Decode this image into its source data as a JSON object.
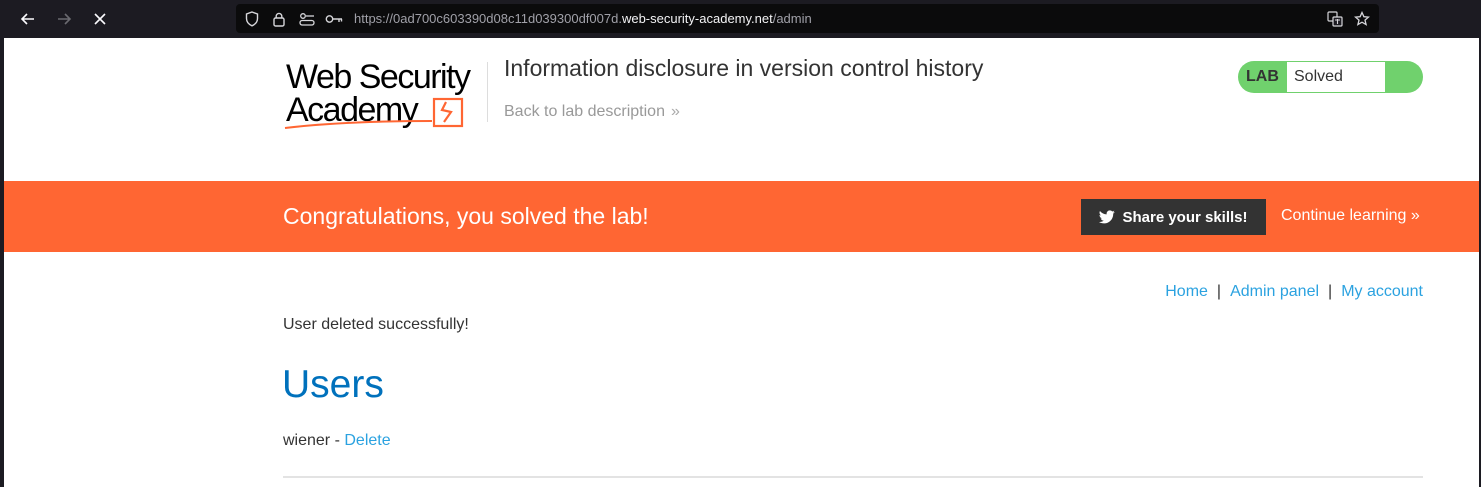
{
  "browser": {
    "url_prefix": "https://0ad700c603390d08c11d039300df007d.",
    "url_domain": "web-security-academy.net",
    "url_path": "/admin"
  },
  "header": {
    "logo_line1": "Web Security",
    "logo_line2": "Academy",
    "lab_title": "Information disclosure in version control history",
    "back_link": "Back to lab description",
    "status_label": "LAB",
    "status_value": "Solved"
  },
  "banner": {
    "message": "Congratulations, you solved the lab!",
    "share_button": "Share your skills!",
    "continue_link": "Continue learning"
  },
  "nav": {
    "home": "Home",
    "separator": "|",
    "admin_panel": "Admin panel",
    "my_account": "My account"
  },
  "main": {
    "notice": "User deleted successfully!",
    "heading": "Users",
    "users": [
      {
        "username": "wiener",
        "separator": " - ",
        "action": "Delete"
      }
    ]
  },
  "colors": {
    "accent_orange": "#ff6633",
    "link_blue": "#2ba2e0",
    "heading_blue": "#0071bc",
    "solved_green": "#70d16d"
  }
}
